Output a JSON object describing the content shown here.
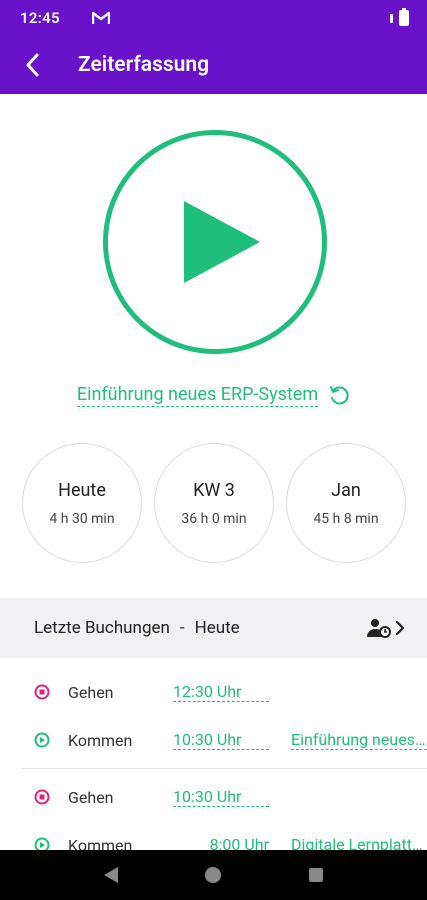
{
  "status_bar": {
    "time": "12:45",
    "app_icon": "gmail-icon"
  },
  "app_bar": {
    "title": "Zeiterfassung",
    "back_icon": "chevron-left-icon"
  },
  "colors": {
    "primary": "#6a12c9",
    "accent": "#1dbf7a",
    "stop": "#e0217a"
  },
  "timer": {
    "project": "Einführung neues ERP-System"
  },
  "stats": [
    {
      "label": "Heute",
      "value": "4 h 30 min"
    },
    {
      "label": "KW 3",
      "value": "36 h 0 min"
    },
    {
      "label": "Jan",
      "value": "45 h 8 min"
    }
  ],
  "bookings_section": {
    "title": "Letzte Buchungen",
    "separator": "-",
    "day": "Heute"
  },
  "bookings": [
    {
      "type": "Gehen",
      "time": "12:30 Uhr",
      "project": "",
      "kind": "stop"
    },
    {
      "type": "Kommen",
      "time": "10:30 Uhr",
      "project": "Einführung neues ERP-System",
      "kind": "start"
    },
    {
      "type": "Gehen",
      "time": "10:30 Uhr",
      "project": "",
      "kind": "stop"
    },
    {
      "type": "Kommen",
      "time": "8:00 Uhr",
      "project": "Digitale Lernplattform",
      "kind": "start"
    }
  ]
}
